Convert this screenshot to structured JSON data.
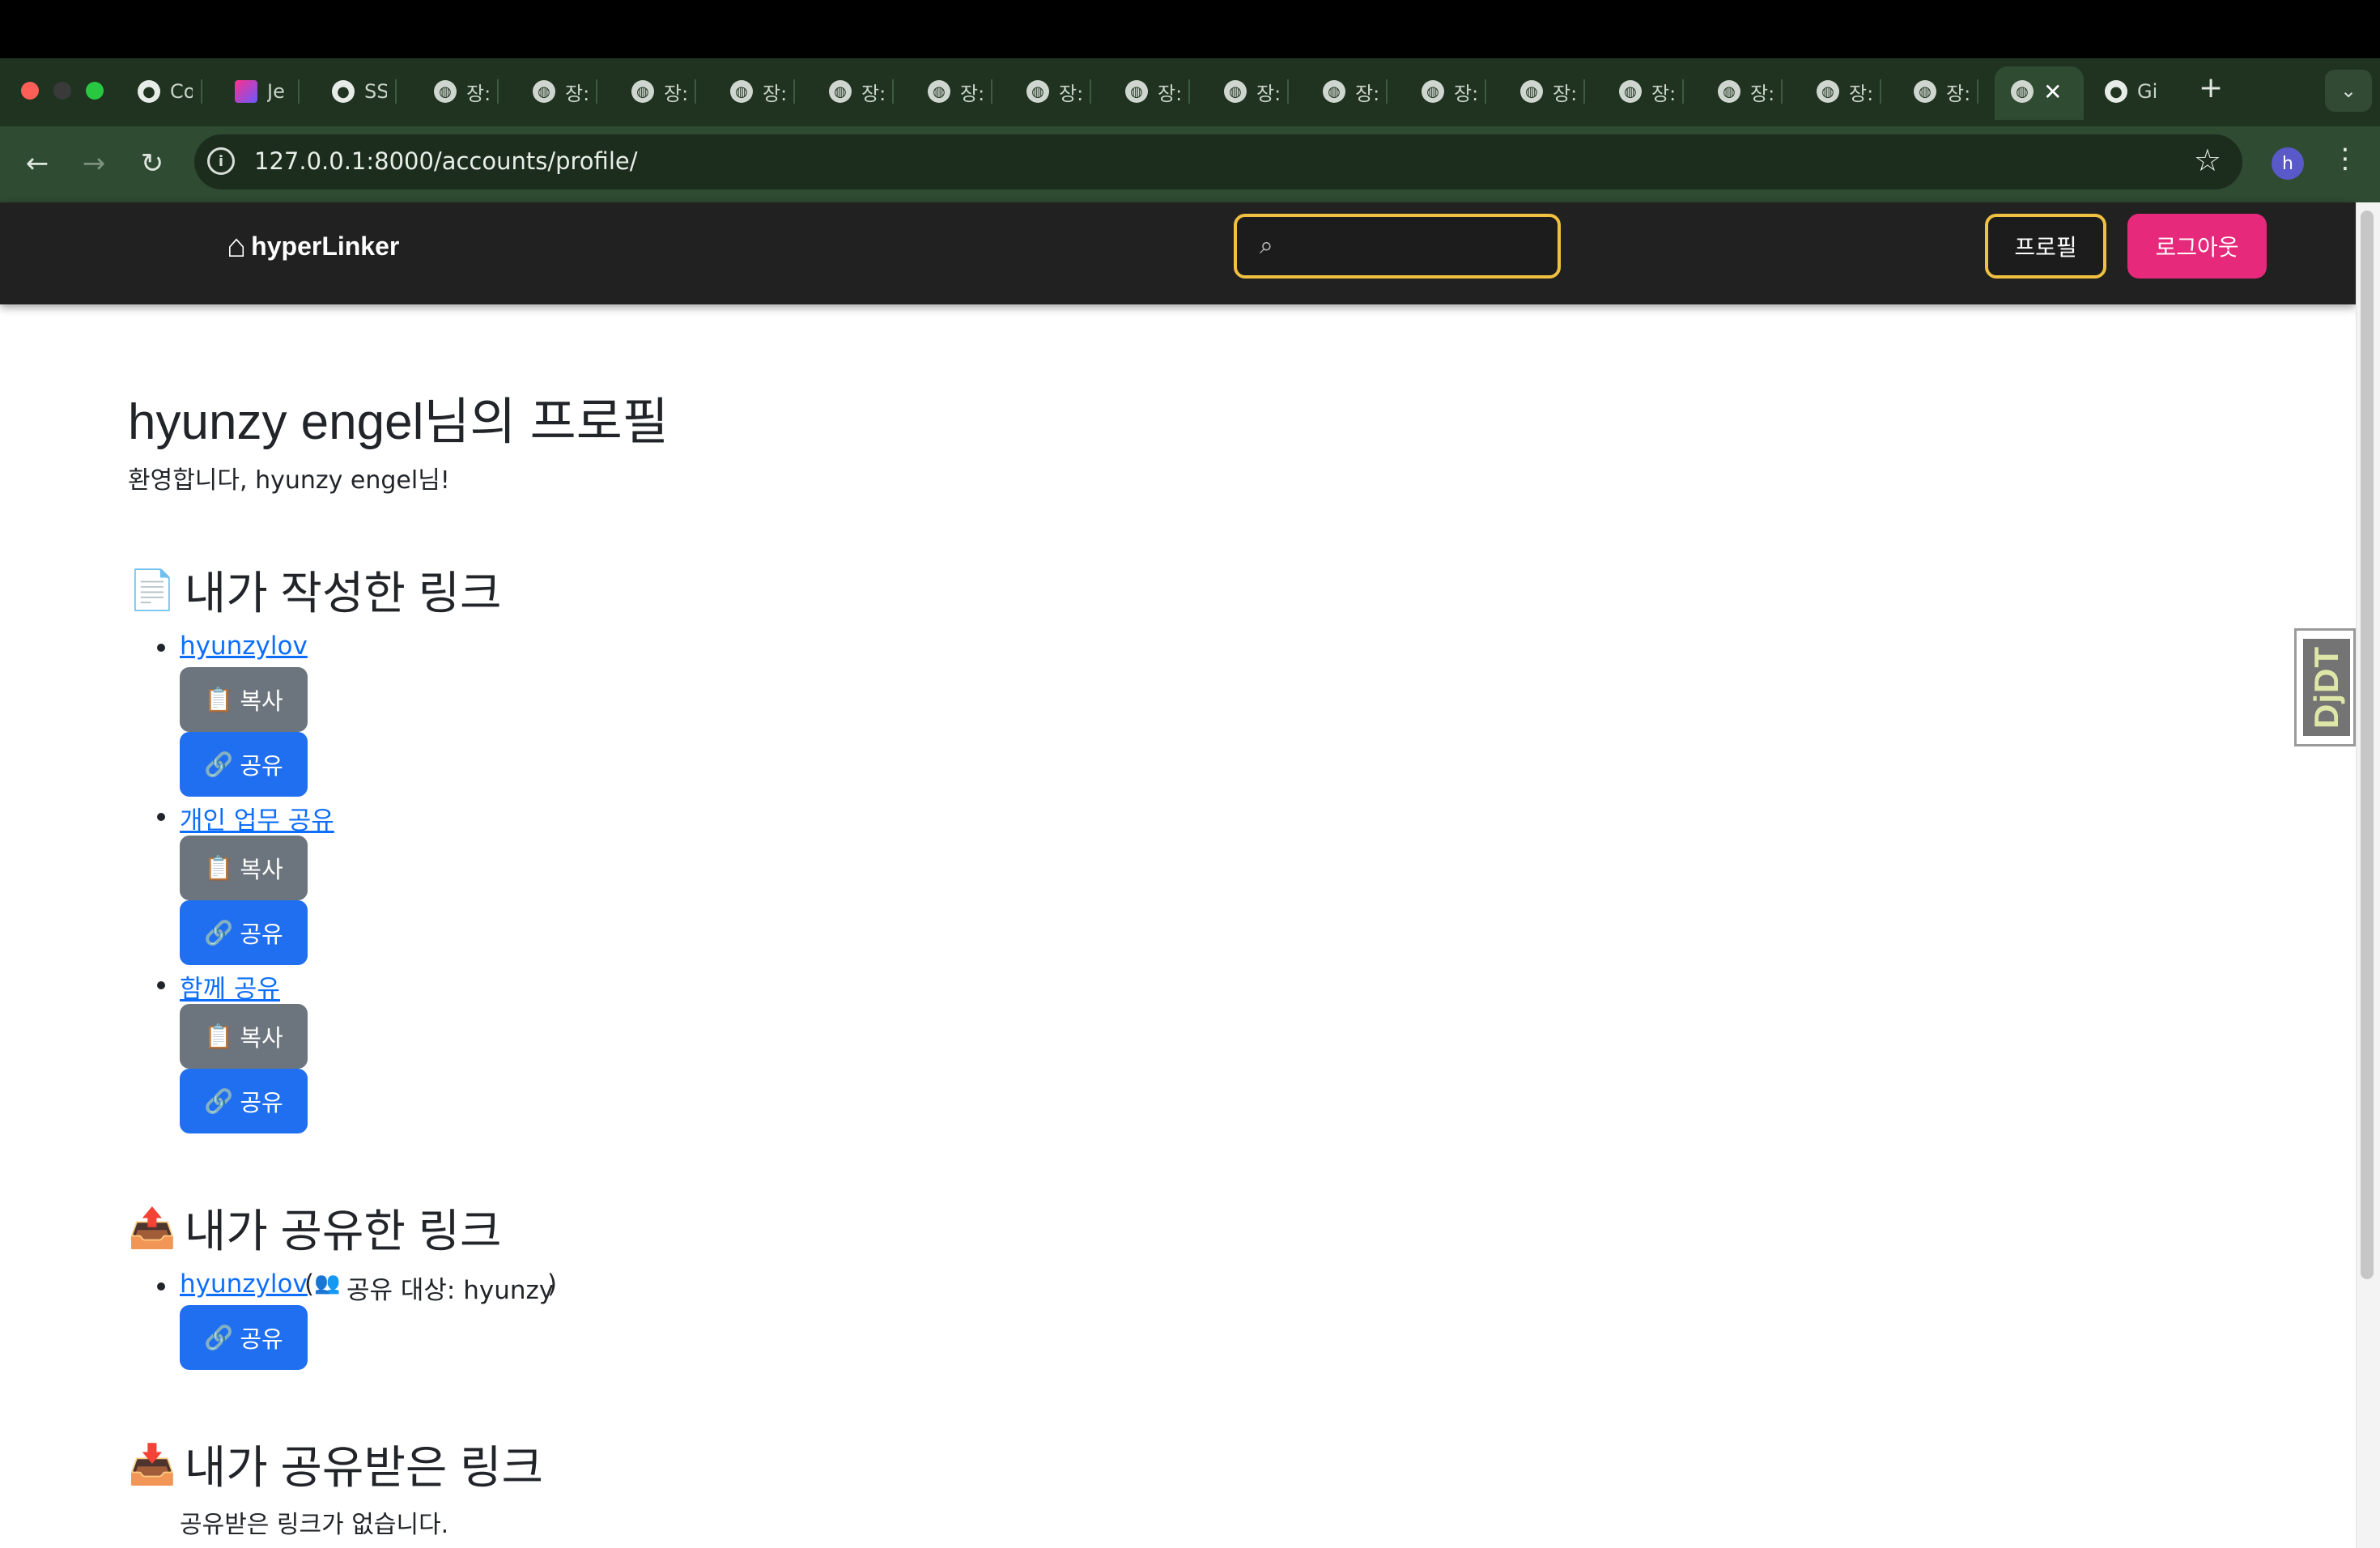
{
  "browser": {
    "tabs": [
      {
        "label": "Co",
        "icon": "github-icon"
      },
      {
        "label": "Je",
        "icon": "jetbrains-icon"
      },
      {
        "label": "SS",
        "icon": "github-icon"
      },
      {
        "label": "장:",
        "icon": "globe-icon"
      },
      {
        "label": "장:",
        "icon": "globe-icon"
      },
      {
        "label": "장:",
        "icon": "globe-icon"
      },
      {
        "label": "장:",
        "icon": "globe-icon"
      },
      {
        "label": "장:",
        "icon": "globe-icon"
      },
      {
        "label": "장:",
        "icon": "globe-icon"
      },
      {
        "label": "장:",
        "icon": "globe-icon"
      },
      {
        "label": "장:",
        "icon": "globe-icon"
      },
      {
        "label": "장:",
        "icon": "globe-icon"
      },
      {
        "label": "장:",
        "icon": "globe-icon"
      },
      {
        "label": "장:",
        "icon": "globe-icon"
      },
      {
        "label": "장:",
        "icon": "globe-icon"
      },
      {
        "label": "장:",
        "icon": "globe-icon"
      },
      {
        "label": "장:",
        "icon": "globe-icon"
      },
      {
        "label": "장:",
        "icon": "globe-icon"
      },
      {
        "label": "장:",
        "icon": "globe-icon"
      }
    ],
    "last_tab_label": "Gi",
    "url": "127.0.0.1:8000/accounts/profile/",
    "profile_initial": "h",
    "new_tab_symbol": "+",
    "close_symbol": "✕",
    "tab_menu_symbol": "⌄"
  },
  "site": {
    "brand": "hyperLinker",
    "search_placeholder": "",
    "profile_button": "프로필",
    "logout_button": "로그아웃",
    "accent_yellow": "#f0c040",
    "accent_pink": "#e6297a"
  },
  "profile": {
    "title": "hyunzy engel님의 프로필",
    "welcome": "환영합니다, hyunzy engel님!",
    "my_links_heading": "내가 작성한 링크",
    "my_links": [
      {
        "name": "hyunzylov"
      },
      {
        "name": "개인 업무 공유"
      },
      {
        "name": "함께 공유"
      }
    ],
    "copy_label": "복사",
    "share_label": "공유",
    "shared_heading": "내가 공유한 링크",
    "shared_links": [
      {
        "name": "hyunzylov",
        "open": "(",
        "target_label": "공유 대상: hyunzy",
        "close": ")"
      }
    ],
    "received_heading": "내가 공유받은 링크",
    "received_empty": "공유받은 링크가 없습니다."
  },
  "debug_toolbar": {
    "label": "DjDT"
  }
}
